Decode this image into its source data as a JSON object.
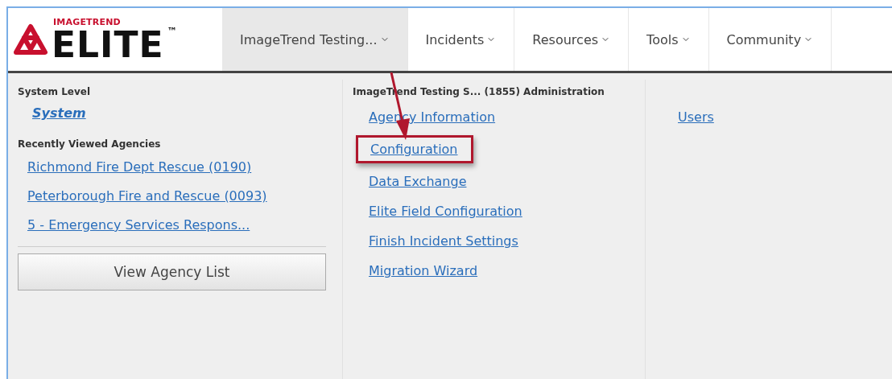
{
  "logo": {
    "brand": "IMAGETREND",
    "product": "ELITE",
    "trademark": "™"
  },
  "nav": [
    {
      "label": "ImageTrend Testing...",
      "selected": true
    },
    {
      "label": "Incidents",
      "selected": false
    },
    {
      "label": "Resources",
      "selected": false
    },
    {
      "label": "Tools",
      "selected": false
    },
    {
      "label": "Community",
      "selected": false
    }
  ],
  "left_column": {
    "system_heading": "System Level",
    "system_link": "System",
    "recent_heading": "Recently Viewed Agencies",
    "recent_agencies": [
      "Richmond Fire Dept Rescue (0190)",
      "Peterborough Fire and Rescue (0093)",
      "5 - Emergency Services Respons..."
    ],
    "button": "View Agency List"
  },
  "middle_column": {
    "heading": "ImageTrend Testing S... (1855) Administration",
    "links": [
      {
        "label": "Agency Information",
        "highlighted": false
      },
      {
        "label": "Configuration",
        "highlighted": true
      },
      {
        "label": "Data Exchange",
        "highlighted": false
      },
      {
        "label": "Elite Field Configuration",
        "highlighted": false
      },
      {
        "label": "Finish Incident Settings",
        "highlighted": false
      },
      {
        "label": "Migration Wizard",
        "highlighted": false
      }
    ]
  },
  "right_column": {
    "links": [
      "Users"
    ]
  }
}
